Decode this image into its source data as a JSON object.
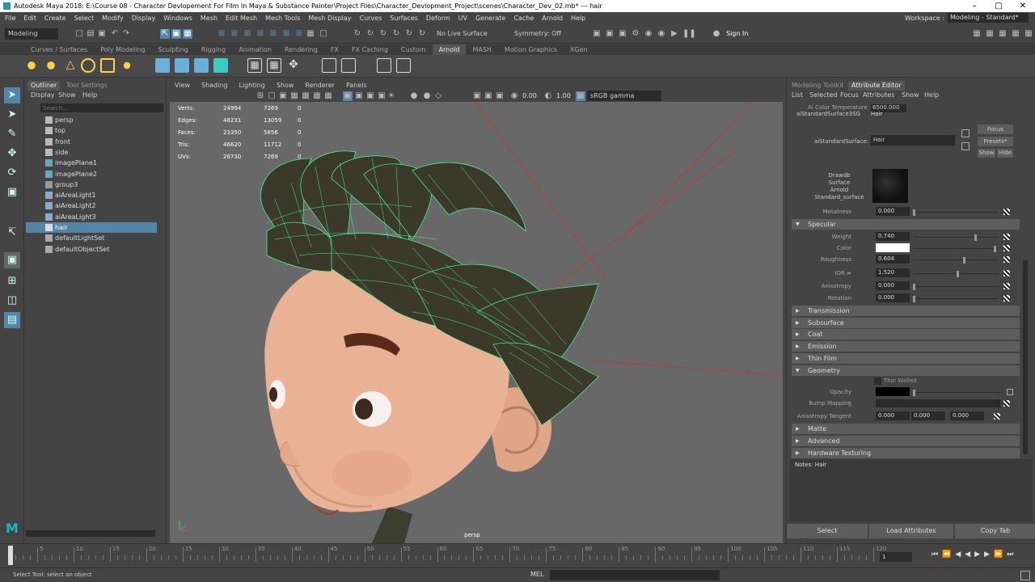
{
  "window": {
    "title": "Autodesk Maya 2018: E:\\Course 08 - Character Devlopement For Film In Maya & Substance Painter\\Project Files\\Character_Devlopment_Project\\scenes\\Character_Dev_02.mb*  ---  hair"
  },
  "menubar": {
    "items": [
      "File",
      "Edit",
      "Create",
      "Select",
      "Modify",
      "Display",
      "Windows",
      "Mesh",
      "Edit Mesh",
      "Mesh Tools",
      "Mesh Display",
      "Curves",
      "Surfaces",
      "Deform",
      "UV",
      "Generate",
      "Cache",
      "Arnold",
      "Help"
    ],
    "workspace_label": "Workspace :",
    "workspace_value": "Modeling - Standard*"
  },
  "statusline": {
    "mode": "Modeling",
    "live_surface": "No Live Surface",
    "symmetry": "Symmetry: Off",
    "signin": "Sign In"
  },
  "shelf": {
    "tabs": [
      "Curves / Surfaces",
      "Poly Modeling",
      "Sculpting",
      "Rigging",
      "Animation",
      "Rendering",
      "FX",
      "FX Caching",
      "Custom",
      "Arnold",
      "MASH",
      "Motion Graphics",
      "XGen"
    ],
    "active_tab": "Arnold"
  },
  "outliner": {
    "tabs": [
      "Outliner",
      "Tool Settings"
    ],
    "menu": [
      "Display",
      "Show",
      "Help"
    ],
    "search_placeholder": "Search...",
    "items": [
      {
        "label": "persp",
        "type": "camera"
      },
      {
        "label": "top",
        "type": "camera"
      },
      {
        "label": "front",
        "type": "camera"
      },
      {
        "label": "side",
        "type": "camera"
      },
      {
        "label": "imagePlane1",
        "type": "image"
      },
      {
        "label": "imagePlane2",
        "type": "image"
      },
      {
        "label": "group3",
        "type": "group"
      },
      {
        "label": "aiAreaLight1",
        "type": "light"
      },
      {
        "label": "aiAreaLight2",
        "type": "light"
      },
      {
        "label": "aiAreaLight3",
        "type": "light"
      },
      {
        "label": "hair",
        "type": "mesh",
        "selected": true
      },
      {
        "label": "defaultLightSet",
        "type": "set"
      },
      {
        "label": "defaultObjectSet",
        "type": "set"
      }
    ]
  },
  "viewport": {
    "menu": [
      "View",
      "Shading",
      "Lighting",
      "Show",
      "Renderer",
      "Panels"
    ],
    "exposure": "0.00",
    "gamma": "1.00",
    "colorspace": "sRGB gamma",
    "camera": "persp",
    "stats": [
      {
        "label": "Verts:",
        "a": "24994",
        "b": "7269",
        "c": "0"
      },
      {
        "label": "Edges:",
        "a": "48231",
        "b": "13059",
        "c": "0"
      },
      {
        "label": "Faces:",
        "a": "23350",
        "b": "5856",
        "c": "0"
      },
      {
        "label": "Tris:",
        "a": "46620",
        "b": "11712",
        "c": "0"
      },
      {
        "label": "UVs:",
        "a": "26730",
        "b": "7269",
        "c": "0"
      }
    ]
  },
  "attr": {
    "tabs": [
      "Modeling Toolkit",
      "Attribute Editor"
    ],
    "menu": [
      "List",
      "Selected",
      "Focus",
      "Attributes",
      "Show",
      "Help"
    ],
    "color_temp_label": "Ai Color Temperature",
    "color_temp_value": "6500.000",
    "node_tab": "aiStandardSurface3SG",
    "node_tab2": "Hair",
    "node_label": "aiStandardSurface:",
    "node_value": "Hair",
    "focus": "Focus",
    "presets": "Presets*",
    "show": "Show",
    "hide": "Hide",
    "swatch_caption": [
      "Drawdb",
      "Surface",
      "Arnold",
      "Standard_surface"
    ],
    "metalness_label": "Metalness",
    "metalness_value": "0.000",
    "specular": {
      "title": "Specular",
      "weight_label": "Weight",
      "weight": "0.740",
      "weight_level": 0.74,
      "color_label": "Color",
      "roughness_label": "Roughness",
      "roughness": "0.604",
      "roughness_level": 0.6,
      "ior_label": "IOR ≠",
      "ior": "1.520",
      "ior_level": 0.52,
      "aniso_label": "Anisotropy",
      "aniso": "0.000",
      "rotation_label": "Rotation",
      "rotation": "0.000"
    },
    "sections": [
      "Transmission",
      "Subsurface",
      "Coat",
      "Emission",
      "Thin Film"
    ],
    "geometry": {
      "title": "Geometry",
      "thin_walled": "Thin Walled",
      "opacity_label": "Opacity",
      "bump_label": "Bump Mapping",
      "aniso_tangent_label": "Anisotropy Tangent",
      "aniso_tangent": [
        "0.000",
        "0.000",
        "0.000"
      ]
    },
    "sections2": [
      "Matte",
      "Advanced",
      "Hardware Texturing"
    ],
    "notes": "Notes:  Hair",
    "buttons": [
      "Select",
      "Load Attributes",
      "Copy Tab"
    ]
  },
  "timeline": {
    "ticks": [
      "1",
      "5",
      "10",
      "15",
      "20",
      "25",
      "30",
      "35",
      "40",
      "45",
      "50",
      "55",
      "60",
      "65",
      "70",
      "75",
      "80",
      "85",
      "90",
      "95",
      "100",
      "105",
      "110",
      "115",
      "120"
    ],
    "current": "1"
  },
  "cmdline": {
    "help": "Select Tool: select an object",
    "lang": "MEL"
  },
  "colors": {
    "accent": "#5285a6",
    "wire": "#4dff9a",
    "skin": "#e8b094"
  }
}
